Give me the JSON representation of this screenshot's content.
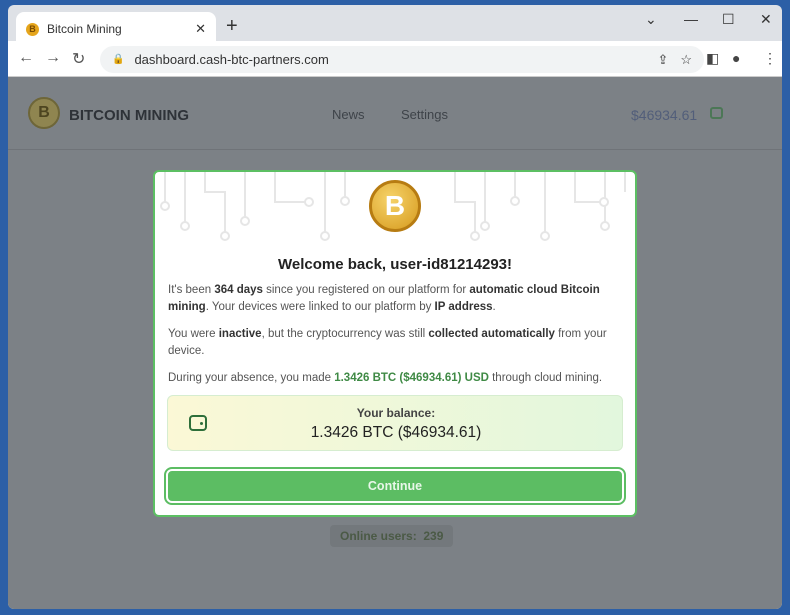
{
  "browser": {
    "tab_title": "Bitcoin Mining",
    "url": "dashboard.cash-btc-partners.com"
  },
  "site": {
    "brand": "BITCOIN MINING",
    "nav": [
      "News",
      "Settings"
    ],
    "balance": "$46934.61",
    "online_label": "Online users:",
    "online_count": "239"
  },
  "modal": {
    "title": "Welcome back, user-id81214293!",
    "p1": [
      "It's been ",
      "364 days",
      " since you registered on our platform for ",
      "automatic cloud Bitcoin mining",
      ". Your devices were linked to our platform by ",
      "IP address",
      "."
    ],
    "p2": [
      "You were ",
      "inactive",
      ", but the cryptocurrency was still ",
      "collected automatically",
      " from your device."
    ],
    "p3": [
      "During your absence, you made ",
      "1.3426 BTC ($46934.61) USD",
      " through cloud mining."
    ],
    "balance_label": "Your balance:",
    "balance_value": "1.3426 BTC ($46934.61)",
    "continue": "Continue"
  },
  "colors": {
    "accent": "#5cbd63",
    "overlay": "#7c8186"
  }
}
